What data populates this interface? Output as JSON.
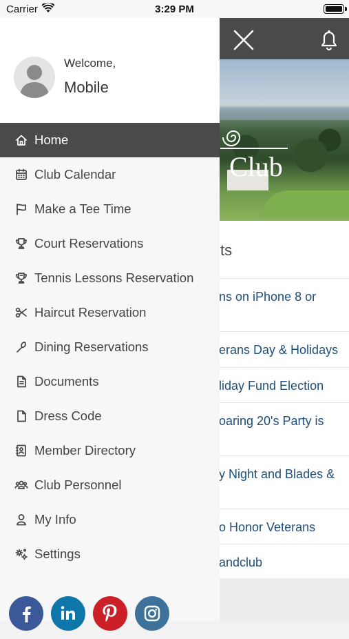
{
  "status_bar": {
    "carrier": "Carrier",
    "time": "3:29 PM"
  },
  "header": {
    "close_icon": "close-icon",
    "bell_icon": "bell-icon"
  },
  "hero": {
    "logo_text": "Club"
  },
  "news": {
    "title_fragment": "ts",
    "items": [
      {
        "lines": [
          "ns on iPhone 8 or",
          ""
        ]
      },
      {
        "lines": [
          "erans Day & Holidays"
        ]
      },
      {
        "lines": [
          "liday Fund Election"
        ]
      },
      {
        "lines": [
          "oaring 20's Party is",
          ""
        ]
      },
      {
        "lines": [
          "y Night and Blades &",
          ""
        ]
      },
      {
        "lines": [
          "o Honor Veterans"
        ]
      },
      {
        "lines": [
          "andclub"
        ]
      }
    ]
  },
  "drawer": {
    "welcome": "Welcome,",
    "username": "Mobile",
    "menu": [
      {
        "label": "Home",
        "icon": "home-icon",
        "active": true
      },
      {
        "label": "Club Calendar",
        "icon": "calendar-icon"
      },
      {
        "label": "Make a Tee Time",
        "icon": "flag-icon"
      },
      {
        "label": "Court Reservations",
        "icon": "trophy-icon"
      },
      {
        "label": "Tennis Lessons Reservation",
        "icon": "tennis-trophy-icon"
      },
      {
        "label": "Haircut Reservation",
        "icon": "scissors-icon"
      },
      {
        "label": "Dining Reservations",
        "icon": "utensils-icon"
      },
      {
        "label": "Documents",
        "icon": "document-icon"
      },
      {
        "label": "Dress Code",
        "icon": "file-icon"
      },
      {
        "label": "Member Directory",
        "icon": "address-book-icon"
      },
      {
        "label": "Club Personnel",
        "icon": "users-icon"
      },
      {
        "label": "My Info",
        "icon": "user-icon"
      },
      {
        "label": "Settings",
        "icon": "gears-icon"
      }
    ],
    "social": [
      {
        "name": "facebook",
        "color": "#3b5998",
        "icon": "facebook-icon"
      },
      {
        "name": "linkedin",
        "color": "#0e76a8",
        "icon": "linkedin-icon"
      },
      {
        "name": "pinterest",
        "color": "#cb2027",
        "icon": "pinterest-icon"
      },
      {
        "name": "instagram",
        "color": "#3f729b",
        "icon": "instagram-icon"
      }
    ]
  },
  "colors": {
    "drawer_active": "#4a4a4a",
    "header": "#4a4a4a",
    "news_link": "#1f4f7a"
  }
}
